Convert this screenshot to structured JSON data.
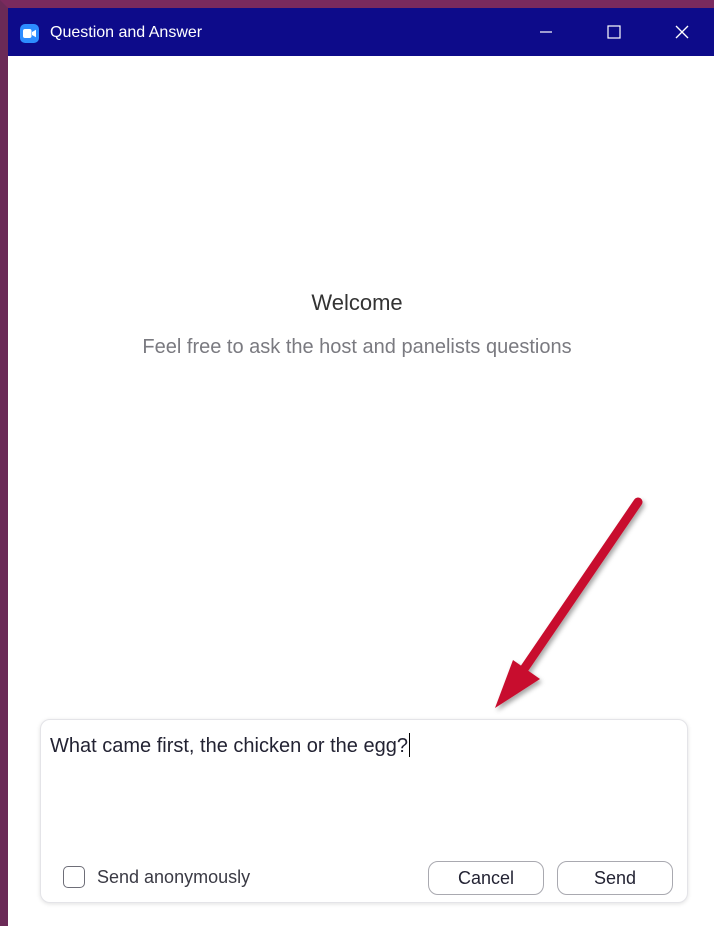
{
  "window": {
    "title": "Question and Answer",
    "icons": {
      "app": "zoom-camera-icon",
      "minimize": "minimize-icon",
      "maximize": "maximize-icon",
      "close": "close-icon"
    },
    "colors": {
      "titlebar": "#0d0b8a",
      "border": "#6b2a57",
      "app_icon": "#2d8cff"
    }
  },
  "main": {
    "welcome_title": "Welcome",
    "welcome_subtitle": "Feel free to ask the host and panelists questions"
  },
  "annotation": {
    "icon": "red-arrow-icon",
    "color": "#c8102e"
  },
  "compose": {
    "question_value": "What came first, the chicken or the egg?",
    "anonymous_label": "Send anonymously",
    "anonymous_checked": false,
    "cancel_label": "Cancel",
    "send_label": "Send"
  }
}
